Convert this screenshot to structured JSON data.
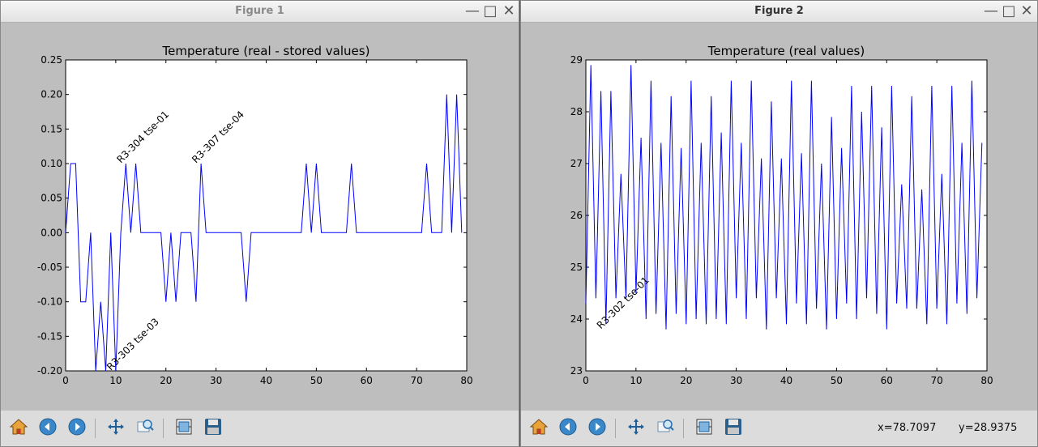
{
  "windows": [
    {
      "title": "Figure 1",
      "chart_data": {
        "type": "line",
        "title": "Temperature (real - stored values)",
        "xlabel": "",
        "ylabel": "",
        "xlim": [
          0,
          80
        ],
        "ylim": [
          -0.2,
          0.25
        ],
        "xticks": [
          0,
          10,
          20,
          30,
          40,
          50,
          60,
          70,
          80
        ],
        "yticks": [
          -0.2,
          -0.15,
          -0.1,
          -0.05,
          0.0,
          0.05,
          0.1,
          0.15,
          0.2,
          0.25
        ],
        "ytick_labels": [
          "-0.20",
          "-0.15",
          "-0.10",
          "-0.05",
          "0.00",
          "0.05",
          "0.10",
          "0.15",
          "0.20",
          "0.25"
        ],
        "xtick_labels": [
          "0",
          "10",
          "20",
          "30",
          "40",
          "50",
          "60",
          "70",
          "80"
        ],
        "series": [
          {
            "color": "#0000ff",
            "points": [
              [
                0,
                0
              ],
              [
                1,
                0.1
              ],
              [
                2,
                0.1
              ],
              [
                3,
                -0.1
              ],
              [
                4,
                -0.1
              ],
              [
                5,
                0
              ],
              [
                6,
                -0.2
              ],
              [
                7,
                -0.1
              ],
              [
                8,
                -0.2
              ],
              [
                9,
                0
              ],
              [
                10,
                -0.2
              ],
              [
                11,
                0
              ],
              [
                12,
                0.1
              ],
              [
                13,
                0
              ],
              [
                14,
                0.1
              ],
              [
                15,
                0
              ],
              [
                16,
                0
              ],
              [
                17,
                0
              ],
              [
                18,
                0
              ],
              [
                19,
                0
              ],
              [
                20,
                -0.1
              ],
              [
                21,
                0
              ],
              [
                22,
                -0.1
              ],
              [
                23,
                0
              ],
              [
                24,
                0
              ],
              [
                25,
                0
              ],
              [
                26,
                -0.1
              ],
              [
                27,
                0.1
              ],
              [
                28,
                0
              ],
              [
                29,
                0
              ],
              [
                30,
                0
              ],
              [
                31,
                0
              ],
              [
                32,
                0
              ],
              [
                33,
                0
              ],
              [
                34,
                0
              ],
              [
                35,
                0
              ],
              [
                36,
                -0.1
              ],
              [
                37,
                0
              ],
              [
                38,
                0
              ],
              [
                39,
                0
              ],
              [
                40,
                0
              ],
              [
                41,
                0
              ],
              [
                42,
                0
              ],
              [
                43,
                0
              ],
              [
                44,
                0
              ],
              [
                45,
                0
              ],
              [
                46,
                0
              ],
              [
                47,
                0
              ],
              [
                48,
                0.1
              ],
              [
                49,
                0
              ],
              [
                50,
                0.1
              ],
              [
                51,
                0
              ],
              [
                52,
                0
              ],
              [
                53,
                0
              ],
              [
                54,
                0
              ],
              [
                55,
                0
              ],
              [
                56,
                0
              ],
              [
                57,
                0.1
              ],
              [
                58,
                0
              ],
              [
                59,
                0
              ],
              [
                60,
                0
              ],
              [
                61,
                0
              ],
              [
                62,
                0
              ],
              [
                63,
                0
              ],
              [
                64,
                0
              ],
              [
                65,
                0
              ],
              [
                66,
                0
              ],
              [
                67,
                0
              ],
              [
                68,
                0
              ],
              [
                69,
                0
              ],
              [
                70,
                0
              ],
              [
                71,
                0
              ],
              [
                72,
                0.1
              ],
              [
                73,
                0
              ],
              [
                74,
                0
              ],
              [
                75,
                0
              ],
              [
                76,
                0.2
              ],
              [
                77,
                0
              ],
              [
                78,
                0.2
              ],
              [
                79,
                0
              ]
            ]
          }
        ],
        "annotations": [
          {
            "text": "R3-304  tse-01",
            "x": 11,
            "y": 0.1
          },
          {
            "text": "R3-307  tse-04",
            "x": 26,
            "y": 0.1
          },
          {
            "text": "R3-303  tse-03",
            "x": 9,
            "y": -0.2
          }
        ]
      },
      "toolbar": {
        "icons": [
          "home-icon",
          "back-icon",
          "forward-icon",
          "pan-icon",
          "zoom-icon",
          "configure-subplots-icon",
          "save-icon"
        ]
      }
    },
    {
      "title": "Figure 2",
      "chart_data": {
        "type": "line",
        "title": "Temperature (real values)",
        "xlabel": "",
        "ylabel": "",
        "xlim": [
          0,
          80
        ],
        "ylim": [
          23,
          29
        ],
        "xticks": [
          0,
          10,
          20,
          30,
          40,
          50,
          60,
          70,
          80
        ],
        "yticks": [
          23,
          24,
          25,
          26,
          27,
          28,
          29
        ],
        "ytick_labels": [
          "23",
          "24",
          "25",
          "26",
          "27",
          "28",
          "29"
        ],
        "xtick_labels": [
          "0",
          "10",
          "20",
          "30",
          "40",
          "50",
          "60",
          "70",
          "80"
        ],
        "series": [
          {
            "color": "#0000ff",
            "points": [
              [
                0,
                24.3
              ],
              [
                1,
                28.9
              ],
              [
                2,
                24.4
              ],
              [
                3,
                28.4
              ],
              [
                4,
                23.9
              ],
              [
                5,
                28.4
              ],
              [
                6,
                24.4
              ],
              [
                7,
                26.8
              ],
              [
                8,
                24.4
              ],
              [
                9,
                28.9
              ],
              [
                10,
                24.5
              ],
              [
                11,
                27.5
              ],
              [
                12,
                24.0
              ],
              [
                13,
                28.6
              ],
              [
                14,
                24.1
              ],
              [
                15,
                27.4
              ],
              [
                16,
                23.8
              ],
              [
                17,
                28.3
              ],
              [
                18,
                24.1
              ],
              [
                19,
                27.3
              ],
              [
                20,
                23.9
              ],
              [
                21,
                28.6
              ],
              [
                22,
                24.0
              ],
              [
                23,
                27.4
              ],
              [
                24,
                23.9
              ],
              [
                25,
                28.3
              ],
              [
                26,
                24.0
              ],
              [
                27,
                27.6
              ],
              [
                28,
                23.9
              ],
              [
                29,
                28.6
              ],
              [
                30,
                24.4
              ],
              [
                31,
                27.4
              ],
              [
                32,
                24.0
              ],
              [
                33,
                28.6
              ],
              [
                34,
                24.4
              ],
              [
                35,
                27.1
              ],
              [
                36,
                23.8
              ],
              [
                37,
                28.2
              ],
              [
                38,
                24.4
              ],
              [
                39,
                27.1
              ],
              [
                40,
                23.9
              ],
              [
                41,
                28.6
              ],
              [
                42,
                24.3
              ],
              [
                43,
                27.2
              ],
              [
                44,
                23.9
              ],
              [
                45,
                28.6
              ],
              [
                46,
                24.2
              ],
              [
                47,
                27.0
              ],
              [
                48,
                23.8
              ],
              [
                49,
                27.9
              ],
              [
                50,
                24.0
              ],
              [
                51,
                27.3
              ],
              [
                52,
                24.3
              ],
              [
                53,
                28.5
              ],
              [
                54,
                24.0
              ],
              [
                55,
                28.0
              ],
              [
                56,
                24.4
              ],
              [
                57,
                28.5
              ],
              [
                58,
                24.1
              ],
              [
                59,
                27.7
              ],
              [
                60,
                23.8
              ],
              [
                61,
                28.5
              ],
              [
                62,
                24.3
              ],
              [
                63,
                26.6
              ],
              [
                64,
                24.2
              ],
              [
                65,
                28.3
              ],
              [
                66,
                24.2
              ],
              [
                67,
                26.5
              ],
              [
                68,
                23.9
              ],
              [
                69,
                28.5
              ],
              [
                70,
                24.2
              ],
              [
                71,
                26.8
              ],
              [
                72,
                23.9
              ],
              [
                73,
                28.5
              ],
              [
                74,
                24.3
              ],
              [
                75,
                27.4
              ],
              [
                76,
                24.1
              ],
              [
                77,
                28.6
              ],
              [
                78,
                24.4
              ],
              [
                79,
                27.4
              ]
            ]
          }
        ],
        "annotations": [
          {
            "text": "R3-302  tse-01",
            "x": 3,
            "y": 23.8
          }
        ]
      },
      "toolbar": {
        "icons": [
          "home-icon",
          "back-icon",
          "forward-icon",
          "pan-icon",
          "zoom-icon",
          "configure-subplots-icon",
          "save-icon"
        ]
      },
      "status": {
        "x_readout": "x=78.7097",
        "y_readout": "y=28.9375"
      }
    }
  ]
}
